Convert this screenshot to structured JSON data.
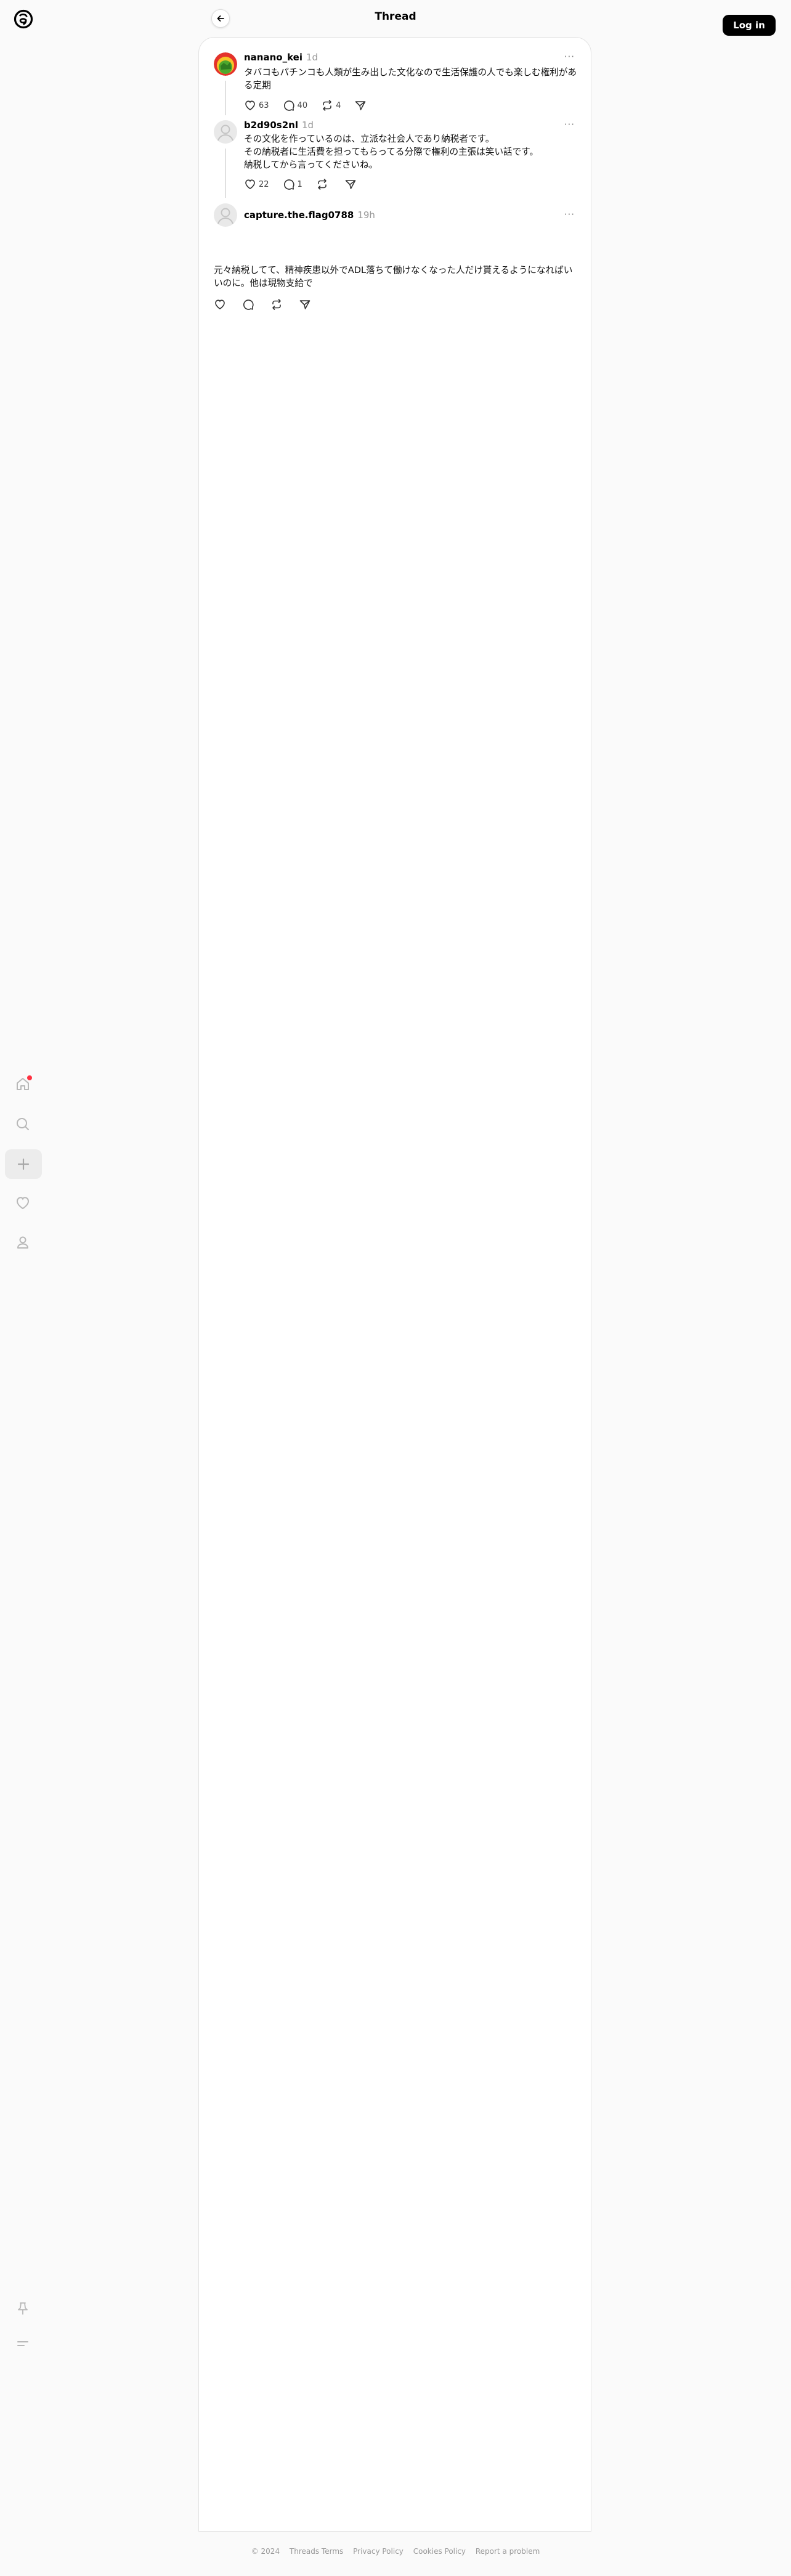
{
  "header": {
    "title": "Thread"
  },
  "login_button": "Log in",
  "posts": [
    {
      "username": "nanano_kei",
      "time": "1d",
      "text": "タバコもパチンコも人類が生み出した文化なので生活保護の人でも楽しむ権利がある定期",
      "likes": "63",
      "replies": "40",
      "reposts": "4"
    },
    {
      "username": "b2d90s2nl",
      "time": "1d",
      "text": "その文化を作っているのは、立派な社会人であり納税者です。\nその納税者に生活費を担ってもらってる分際で権利の主張は笑い話です。\n納税してから言ってくださいね。",
      "likes": "22",
      "replies": "1"
    },
    {
      "username": "capture.the.flag0788",
      "time": "19h",
      "text": "元々納税してて、精神疾患以外でADL落ちて働けなくなった人だけ貰えるようになればいいのに。他は現物支給で"
    }
  ],
  "footer": [
    "© 2024",
    "Threads Terms",
    "Privacy Policy",
    "Cookies Policy",
    "Report a problem"
  ],
  "colors": {
    "accent": "#000000",
    "notification": "#ff3040",
    "background": "#fafafa"
  }
}
